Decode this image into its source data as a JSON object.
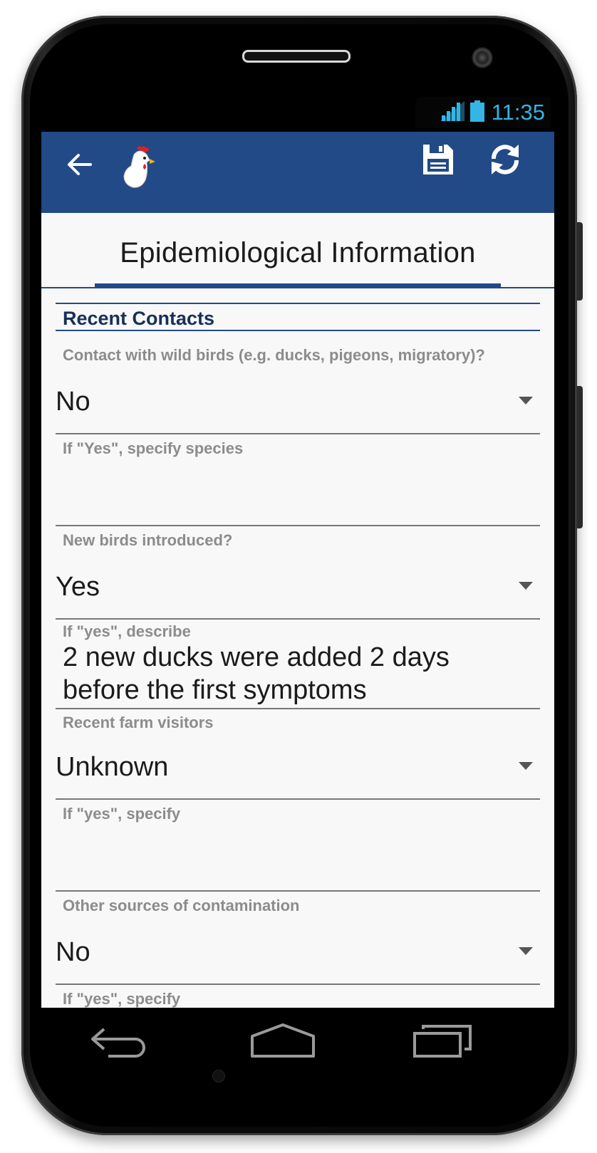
{
  "status_bar": {
    "time": "11:35",
    "signal_icon": "signal-icon",
    "battery_icon": "battery-icon",
    "accent_color": "#33b5e5"
  },
  "app_bar": {
    "background_color": "#214a87",
    "back_icon": "back-arrow-icon",
    "logo_icon": "chicken-logo-icon",
    "save_icon": "save-icon",
    "sync_icon": "sync-icon"
  },
  "tab": {
    "label": "Epidemiological Information"
  },
  "section": {
    "title": "Recent Contacts"
  },
  "fields": {
    "wild_birds": {
      "label": "Contact with wild birds (e.g. ducks, pigeons, migratory)?",
      "value": "No"
    },
    "wild_birds_species": {
      "label": "If \"Yes\", specify species",
      "value": ""
    },
    "new_birds": {
      "label": "New birds introduced?",
      "value": "Yes"
    },
    "new_birds_describe": {
      "label": "If \"yes\", describe",
      "value": "2 new ducks were added 2 days before the first symptoms"
    },
    "farm_visitors": {
      "label": "Recent farm visitors",
      "value": "Unknown"
    },
    "farm_visitors_specify": {
      "label": "If \"yes\", specify",
      "value": ""
    },
    "other_sources": {
      "label": "Other sources of contamination",
      "value": "No"
    },
    "other_sources_specify": {
      "label": "If \"yes\", specify",
      "value": ""
    }
  },
  "nav_bar": {
    "back_icon": "nav-back-icon",
    "home_icon": "nav-home-icon",
    "recents_icon": "nav-recents-icon"
  }
}
